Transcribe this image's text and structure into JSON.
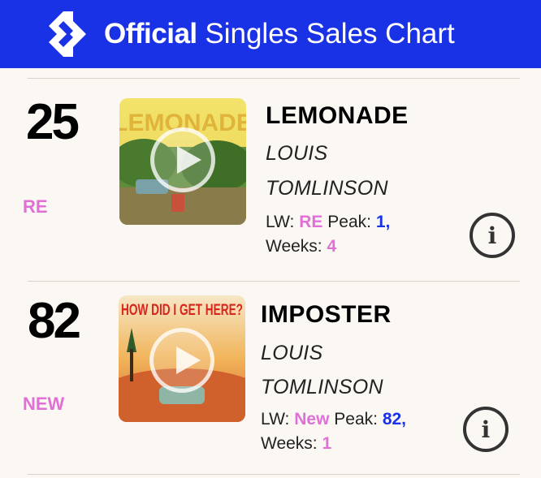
{
  "header": {
    "brand_bold": "Official",
    "brand_light": "Singles Sales Chart",
    "brand_color": "#1a32e6",
    "logo_icon": "official-charts-logo-icon"
  },
  "entries": [
    {
      "position": "25",
      "movement": "RE",
      "title": "LEMONADE",
      "artist_line1": "LOUIS",
      "artist_line2": "TOMLINSON",
      "lw_label": "LW:",
      "lw_value": "RE",
      "peak_label": "Peak:",
      "peak_value": "1,",
      "weeks_label": "Weeks:",
      "weeks_value": "4",
      "artwork_text": "LEMONADE",
      "artwork_icon": "album-art-lemonade",
      "play_icon": "play-icon",
      "info_icon": "info-icon",
      "info_glyph": "i"
    },
    {
      "position": "82",
      "movement": "NEW",
      "title": "IMPOSTER",
      "artist_line1": "LOUIS",
      "artist_line2": "TOMLINSON",
      "lw_label": "LW:",
      "lw_value": "New",
      "peak_label": "Peak:",
      "peak_value": "82,",
      "weeks_label": "Weeks:",
      "weeks_value": "1",
      "artwork_text": "HOW DID I GET HERE?",
      "artwork_icon": "album-art-how-did-i-get-here",
      "play_icon": "play-icon",
      "info_icon": "info-icon",
      "info_glyph": "i"
    }
  ],
  "colors": {
    "movement_pink": "#e06fd6",
    "stat_blue": "#1a32e6",
    "background": "#fbf8f4"
  }
}
